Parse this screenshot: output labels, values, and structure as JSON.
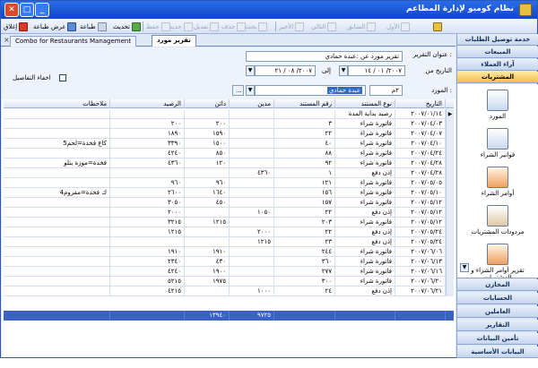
{
  "window": {
    "title": "نظام كومبو لإدارة المطاعم",
    "close": "✕",
    "max": "□",
    "min": "_"
  },
  "toolbar": {
    "exit": "إغلاق",
    "preview": "عرض طباعة",
    "print": "طباعة",
    "refresh": "تحديث",
    "save": "حفظ",
    "new": "جديد",
    "edit": "تعديل",
    "del": "حذف",
    "srch": "بحث",
    "last": "الأخير",
    "next": "التالي",
    "prev": "السابق",
    "first": "الأول"
  },
  "tabs": {
    "active": "تقرير مورد",
    "other": "Combo for Restaurants Management",
    "close": "×"
  },
  "form": {
    "title_label": "عنوان التقرير :",
    "title_value": "تقرير مورد عن :عبدة حمادي",
    "date_label": "التاريخ  من",
    "date_from": "٢٠٠٧/ ٠١ / ١٤",
    "to_label": "إلى",
    "date_to": "٢٠٠٧/ ٠٨ / ٢١",
    "supplier_label": "المورد :",
    "supplier_code": "٢م",
    "supplier_name": "عبدة حمادي",
    "browse": "...",
    "hide_label": "اخفاء التفاصيل",
    "dd": "▼"
  },
  "grid": {
    "columns": [
      "التاريخ",
      "نوع المستند",
      "رقم المستند",
      "مدين",
      "دائن",
      "الرصيد",
      "ملاحظات"
    ],
    "rows": [
      [
        "٢٠٠٧/٠١/١٤",
        "رصيد بداية المدة",
        "",
        "",
        "",
        "",
        ""
      ],
      [
        "٢٠٠٧/٠٤/٠٣",
        "فاتورة شراء",
        "٣",
        "",
        "٢٠٠",
        "٢٠٠",
        ""
      ],
      [
        "٢٠٠٧/٠٤/٠٧",
        "فاتورة شراء",
        "٢٢",
        "",
        "١٥٩٠",
        "١٨٩٠",
        ""
      ],
      [
        "٢٠٠٧/٠٤/١٠",
        "فاتورة شراء",
        "٤٠",
        "",
        "١٥٠٠",
        "٣٣٩٠",
        "5كاع فخدة=لحم"
      ],
      [
        "٢٠٠٧/٠٤/٢٤",
        "فاتورة شراء",
        "٨٨",
        "",
        "٨٥٠",
        "٤٢٤٠",
        ""
      ],
      [
        "٢٠٠٧/٠٤/٢٨",
        "فاتورة شراء",
        "٩٢",
        "",
        "١٢٠",
        "٤٣٦٠",
        "فخدة=موزة بتلو"
      ],
      [
        "٢٠٠٧/٠٤/٢٨",
        "إذن دفع",
        "١",
        "٤٣٦٠",
        "",
        "",
        ""
      ],
      [
        "٢٠٠٧/٠٥/٠٥",
        "فاتورة شراء",
        "١٢١",
        "",
        "٩٦٠",
        "٩٦٠",
        ""
      ],
      [
        "٢٠٠٧/٠٥/١٠",
        "فاتورة شراء",
        "١٥٦",
        "",
        "١٦٤٠",
        "٢٦٠٠",
        "4ك فخدة=مفروم"
      ],
      [
        "٢٠٠٧/٠٥/١٢",
        "فاتورة شراء",
        "١٥٧",
        "",
        "٤٥٠",
        "٣٠٥٠",
        ""
      ],
      [
        "٢٠٠٧/٠٥/١٢",
        "إذن دفع",
        "٢٢",
        "١٠٥٠",
        "",
        "٢٠٠٠",
        ""
      ],
      [
        "٢٠٠٧/٠٥/١٢",
        "فاتورة شراء",
        "٢٠٣",
        "",
        "١٢١٥",
        "٣٢١٥",
        ""
      ],
      [
        "٢٠٠٧/٠٥/٢٤",
        "إذن دفع",
        "٢٢",
        "٢٠٠٠",
        "",
        "١٢١٥",
        ""
      ],
      [
        "٢٠٠٧/٠٥/٢٤",
        "إذن دفع",
        "٢٣",
        "١٢١٥",
        "",
        "",
        ""
      ],
      [
        "٢٠٠٧/٠٦/٠٦",
        "فاتورة شراء",
        "٢٤٤",
        "",
        "١٩١٠",
        "١٩١٠",
        ""
      ],
      [
        "٢٠٠٧/٠٦/١٣",
        "فاتورة شراء",
        "٣٦٠",
        "",
        "٤٣٠",
        "٢٣٤٠",
        ""
      ],
      [
        "٢٠٠٧/٠٦/١٦",
        "فاتورة شراء",
        "٢٧٧",
        "",
        "١٩٠٠",
        "٤٢٤٠",
        ""
      ],
      [
        "٢٠٠٧/٠٦/٢٠",
        "فاتورة شراء",
        "٣٠٠",
        "",
        "١٩٧٥",
        "٥٢١٥",
        ""
      ],
      [
        "٢٠٠٧/٠٦/٢١",
        "إذن دفع",
        "٢٤",
        "١٠٠٠",
        "",
        "٤٢١٥",
        ""
      ]
    ],
    "footer": [
      "",
      "",
      "",
      "٩٧٢٥",
      "١٣٩٤٠",
      "",
      ""
    ],
    "indicator": "▶"
  },
  "sidebar": {
    "headers_top": [
      "خدمة توصيل الطلبات",
      "المبيعات",
      "آراء العملاء",
      "المشتريات"
    ],
    "items": [
      "المورد",
      "فواتير الشراء",
      "أوامر الشراء",
      "مردودات المشتريات",
      "تقرير أوامر الشراء و المشتريات"
    ],
    "headers_bottom": [
      "المخازن",
      "الحسابات",
      "العاملين",
      "التقارير",
      "تأمين البيانات",
      "البيانات الأساسية"
    ],
    "scroll": "▼"
  }
}
